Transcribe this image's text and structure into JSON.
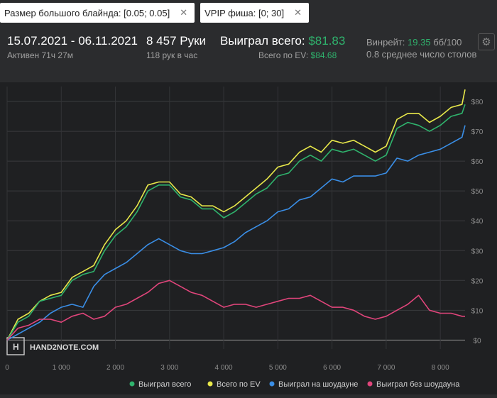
{
  "filters": [
    {
      "label": "Размер большого блайнда: [0.05; 0.05]",
      "close": "✕"
    },
    {
      "label": "VPIP фиша: [0; 30]",
      "close": "✕"
    }
  ],
  "stats": {
    "date_range": "15.07.2021 - 06.11.2021",
    "active": "Активен 71ч 27м",
    "hands": "8 457 Руки",
    "hands_per_hour": "118 рук в час",
    "won_label": "Выиграл всего:",
    "won_value": "$81.83",
    "ev_label": "Всего по EV:",
    "ev_value": "$84.68",
    "winrate_label": "Винрейт:",
    "winrate_value": "19.35",
    "winrate_unit": "бб/100",
    "tables": "0.8 среднее число столов"
  },
  "settings_icon": "gear-icon",
  "watermark": "HAND2NOTE.COM",
  "chart_data": {
    "type": "line",
    "xlim": [
      0,
      8457
    ],
    "ylim": [
      -3,
      85
    ],
    "x_ticks": [
      0,
      1000,
      2000,
      3000,
      4000,
      5000,
      6000,
      7000,
      8000
    ],
    "x_tick_labels": [
      "0",
      "1 000",
      "2 000",
      "3 000",
      "4 000",
      "5 000",
      "6 000",
      "7 000",
      "8 000"
    ],
    "y_ticks": [
      0,
      10,
      20,
      30,
      40,
      50,
      60,
      70,
      80
    ],
    "y_tick_labels": [
      "$0",
      "$10",
      "$20",
      "$30",
      "$40",
      "$50",
      "$60",
      "$70",
      "$80"
    ],
    "grid": true,
    "legend_position": "bottom",
    "x": [
      0,
      200,
      400,
      600,
      800,
      1000,
      1200,
      1400,
      1600,
      1800,
      2000,
      2200,
      2400,
      2600,
      2800,
      3000,
      3200,
      3400,
      3600,
      3800,
      4000,
      4200,
      4400,
      4600,
      4800,
      5000,
      5200,
      5400,
      5600,
      5800,
      6000,
      6200,
      6400,
      6600,
      6800,
      7000,
      7200,
      7400,
      7600,
      7800,
      8000,
      8200,
      8400,
      8457
    ],
    "series": [
      {
        "name": "Выиграл всего",
        "color": "#2fb36d",
        "values": [
          0,
          6,
          8,
          13,
          14,
          15,
          20,
          22,
          23,
          30,
          35,
          38,
          43,
          50,
          52,
          52,
          48,
          47,
          44,
          44,
          41,
          43,
          46,
          49,
          51,
          55,
          56,
          60,
          62,
          60,
          64,
          63,
          64,
          62,
          60,
          62,
          71,
          73,
          72,
          70,
          72,
          75,
          76,
          79
        ]
      },
      {
        "name": "Всего по EV",
        "color": "#e8e84a",
        "values": [
          0,
          7,
          9,
          13,
          15,
          16,
          21,
          23,
          25,
          32,
          37,
          40,
          45,
          52,
          53,
          53,
          49,
          48,
          45,
          45,
          43,
          45,
          48,
          51,
          54,
          58,
          59,
          63,
          65,
          63,
          67,
          66,
          67,
          65,
          63,
          65,
          74,
          76,
          76,
          73,
          75,
          78,
          79,
          84
        ]
      },
      {
        "name": "Выиграл на шоудауне",
        "color": "#3a8ee6",
        "values": [
          0,
          2,
          4,
          6,
          9,
          11,
          12,
          11,
          18,
          22,
          24,
          26,
          29,
          32,
          34,
          32,
          30,
          29,
          29,
          30,
          31,
          33,
          36,
          38,
          40,
          43,
          44,
          47,
          48,
          51,
          54,
          53,
          55,
          55,
          55,
          56,
          61,
          60,
          62,
          63,
          64,
          66,
          68,
          72
        ]
      },
      {
        "name": "Выиграл без шоудауна",
        "color": "#e0457b",
        "values": [
          0,
          4,
          5,
          7,
          7,
          6,
          8,
          9,
          7,
          8,
          11,
          12,
          14,
          16,
          19,
          20,
          18,
          16,
          15,
          13,
          11,
          12,
          12,
          11,
          12,
          13,
          14,
          14,
          15,
          13,
          11,
          11,
          10,
          8,
          7,
          8,
          10,
          12,
          15,
          10,
          9,
          9,
          8,
          8
        ]
      }
    ]
  }
}
